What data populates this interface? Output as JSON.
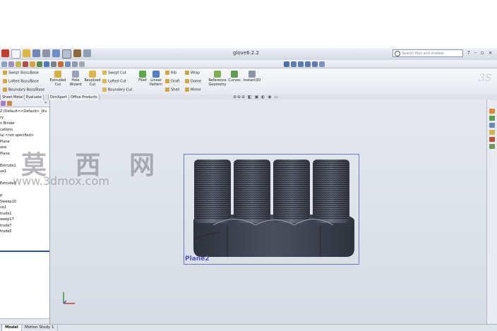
{
  "window": {
    "title": "glove6.2.2"
  },
  "search": {
    "placeholder": "Search files and models"
  },
  "window_controls": "? - ▫ ×",
  "ribbon": {
    "boss_items": [
      "Swept Boss/Base",
      "Lofted Boss/Base",
      "Boundary Boss/Base"
    ],
    "cut_buttons": [
      {
        "label": "Extruded Cut",
        "color": "#d8b23a"
      },
      {
        "label": "Hole Wizard",
        "color": "#9aa5b5"
      },
      {
        "label": "Revolved Cut",
        "color": "#e0b64a"
      }
    ],
    "cut_items": [
      "Swept Cut",
      "Lofted Cut",
      "Boundary Cut"
    ],
    "fillet": "Fillet",
    "linear_pattern": "Linear Pattern",
    "features": [
      "Rib",
      "Draft",
      "Shell",
      "Wrap",
      "Dome",
      "Mirror"
    ],
    "reference_geometry": "Reference Geometry",
    "curves": "Curves",
    "instant3d": "Instant3D"
  },
  "tabs": [
    "Sheet Metal",
    "Evaluate",
    "DimXpert",
    "Office Products"
  ],
  "tree": {
    "items": [
      "2 (Default<<Default>_Dis",
      "ry",
      "n Binder",
      "cations",
      "ial <not specified>",
      "Plane",
      "ane",
      "Plane",
      "",
      "Extrude1",
      "ve1",
      "",
      "Extrude2",
      "",
      "p",
      "Sweep10",
      "ve1",
      "trude1",
      "weep17",
      "trude7",
      "trude5"
    ]
  },
  "viewport": {
    "plane_label": "Plane2"
  },
  "watermark": {
    "cn": "莫 西 网",
    "url": "www.3dmox.com"
  },
  "bottom_tabs": [
    "Model",
    "Motion Study 1"
  ],
  "colors": {
    "accent": "#2b4aa8",
    "plane_border": "#6b78c6",
    "model_dark": "#3b3f4c"
  }
}
